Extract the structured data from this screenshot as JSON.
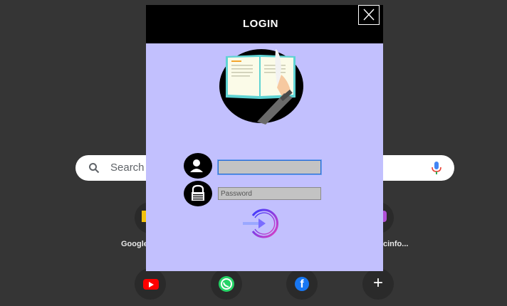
{
  "background": {
    "search_placeholder": "Search",
    "shortcuts": [
      {
        "label": "Google"
      },
      {
        "label": "cinfo..."
      }
    ],
    "bottom_shortcuts": [
      "youtube-icon",
      "whatsapp-icon",
      "facebook-icon",
      "add-icon"
    ]
  },
  "modal": {
    "title": "LOGIN",
    "close_icon": "close-icon",
    "username": {
      "value": "",
      "placeholder": ""
    },
    "password": {
      "value": "",
      "placeholder": "Password"
    },
    "submit_icon": "login-arrow-icon"
  },
  "colors": {
    "modal_bg": "#c2c0fe",
    "header_bg": "#000000",
    "page_bg": "#353535",
    "input_bg": "#c3c3c3",
    "focus_border": "#2a6cd8"
  }
}
